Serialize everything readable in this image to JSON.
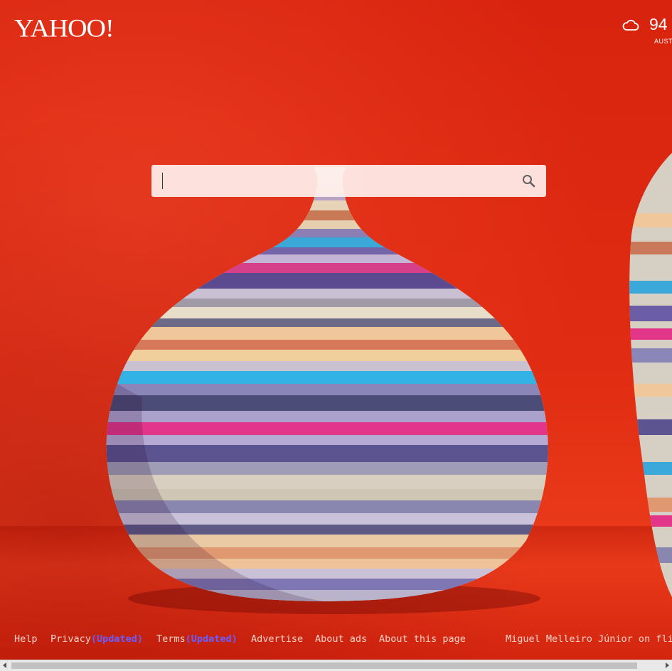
{
  "header": {
    "logo_text": "YAHOO!",
    "weather": {
      "icon": "cloud-icon",
      "temperature": "94",
      "location": "AUST"
    }
  },
  "search": {
    "value": "",
    "placeholder": "",
    "button_icon": "search-icon"
  },
  "footer": {
    "help": "Help",
    "privacy": "Privacy",
    "privacy_updated": "(Updated)",
    "terms": "Terms",
    "terms_updated": "(Updated)",
    "advertise": "Advertise",
    "about_ads": "About ads",
    "about_page": "About this page",
    "credit": "Miguel Melleiro Júnior on flic"
  },
  "colors": {
    "background_red": "#d9260f",
    "updated_link": "#6a5cff",
    "footer_text": "#f7d2c9"
  }
}
